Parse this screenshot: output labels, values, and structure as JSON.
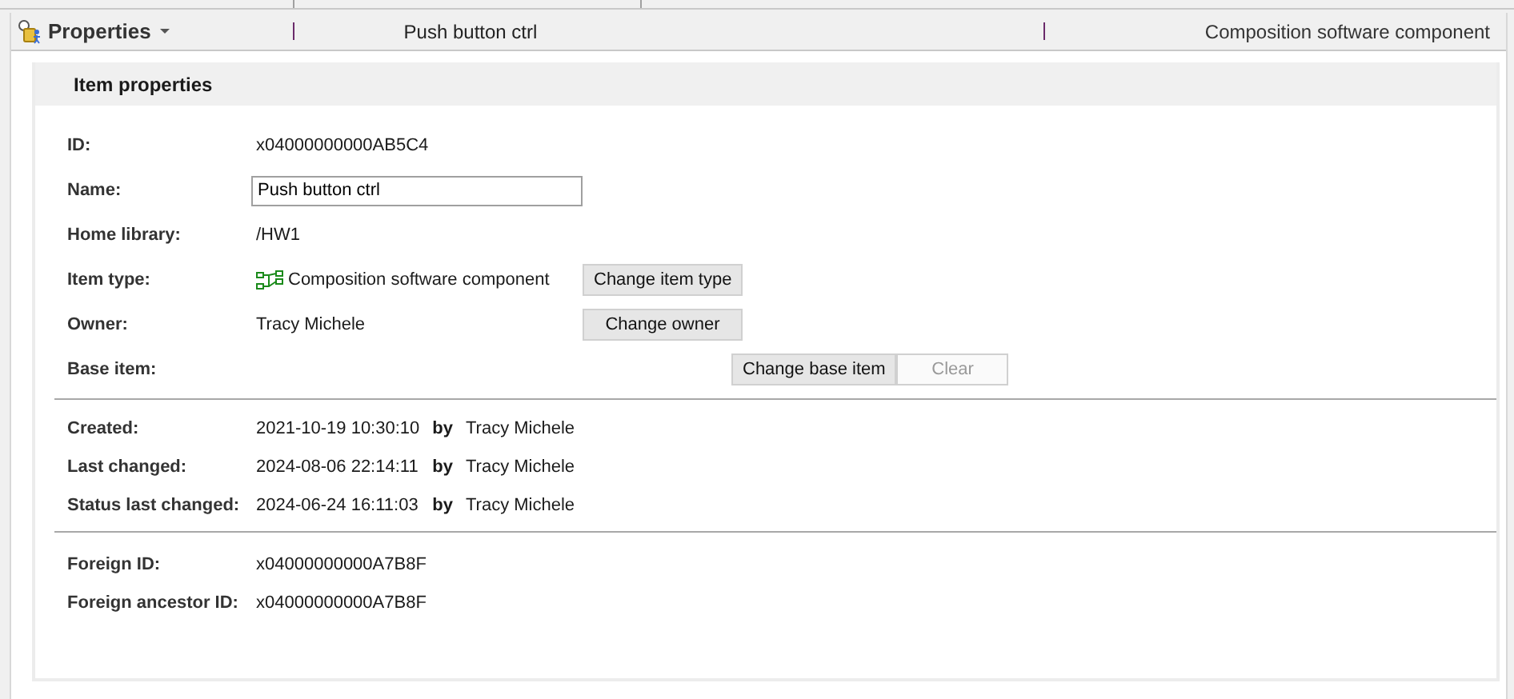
{
  "header": {
    "title": "Properties",
    "object_name": "Push button ctrl",
    "object_type": "Composition software component"
  },
  "panel": {
    "title": "Item properties",
    "fields": [
      {
        "kind": "text",
        "label": "ID:",
        "value": "x04000000000AB5C4"
      },
      {
        "kind": "input",
        "label": "Name:",
        "value": "Push button ctrl"
      },
      {
        "kind": "text",
        "label": "Home library:",
        "value": "/HW1"
      },
      {
        "kind": "typed",
        "label": "Item type:",
        "value": "Composition software component",
        "buttons": [
          {
            "label": "Change item type",
            "disabled": false
          }
        ]
      },
      {
        "kind": "text",
        "label": "Owner:",
        "value": "Tracy Michele",
        "buttons": [
          {
            "label": "Change owner",
            "disabled": false
          }
        ]
      },
      {
        "kind": "text",
        "label": "Base item:",
        "buttons": [
          {
            "label": "Change base item",
            "disabled": false
          },
          {
            "label": "Clear",
            "disabled": true
          }
        ]
      }
    ],
    "history": [
      {
        "label": "Created:",
        "date": "2021-10-19 10:30:10",
        "by": "by",
        "user": "Tracy Michele"
      },
      {
        "label": "Last changed:",
        "date": "2024-08-06 22:14:11",
        "by": "by",
        "user": "Tracy Michele"
      },
      {
        "label": "Status last changed:",
        "date": "2024-06-24 16:11:03",
        "by": "by",
        "user": "Tracy Michele"
      }
    ],
    "foreign": [
      {
        "label": "Foreign ID:",
        "value": "x04000000000A7B8F"
      },
      {
        "label": "Foreign ancestor ID:",
        "value": "x04000000000A7B8F"
      }
    ]
  }
}
